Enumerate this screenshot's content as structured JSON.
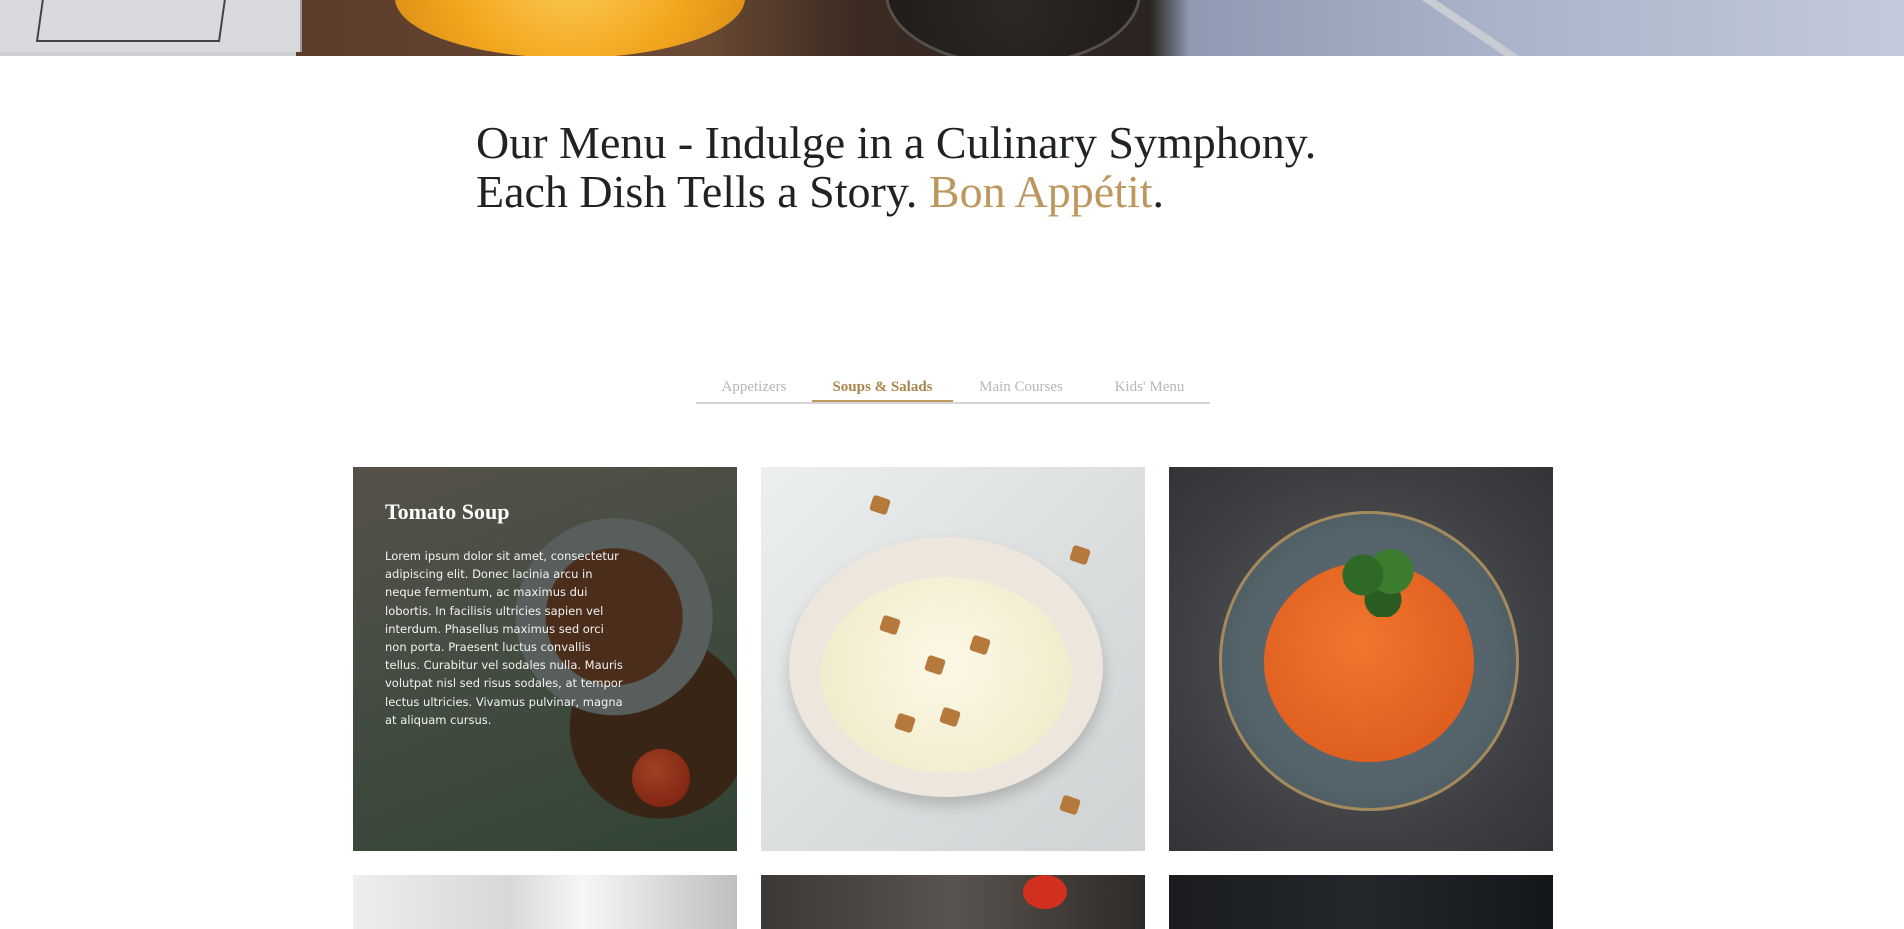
{
  "heading": {
    "line1": "Our Menu - Indulge in a Culinary Symphony.",
    "line2_prefix": "Each Dish Tells a Story. ",
    "line2_accent": "Bon Appétit",
    "line2_suffix": "."
  },
  "tabs": [
    {
      "label": "Appetizers",
      "active": false
    },
    {
      "label": "Soups & Salads",
      "active": true
    },
    {
      "label": "Main Courses",
      "active": false
    },
    {
      "label": "Kids' Menu",
      "active": false
    }
  ],
  "tiles": [
    {
      "title": "Tomato Soup",
      "description": "Lorem ipsum dolor sit amet, consectetur adipiscing elit. Donec lacinia arcu in neque fermentum, ac maximus dui lobortis. In facilisis ultricies sapien vel interdum. Phasellus maximus sed orci non porta. Praesent luctus convallis tellus. Curabitur vel sodales nulla. Mauris volutpat nisl sed risus sodales, at tempor lectus ultricies. Vivamus pulvinar, magna at aliquam cursus."
    }
  ],
  "colors": {
    "accent": "#bd975e",
    "tab_active": "#a98651",
    "tab_inactive": "#b7b7b7",
    "heading": "#1f2321"
  }
}
